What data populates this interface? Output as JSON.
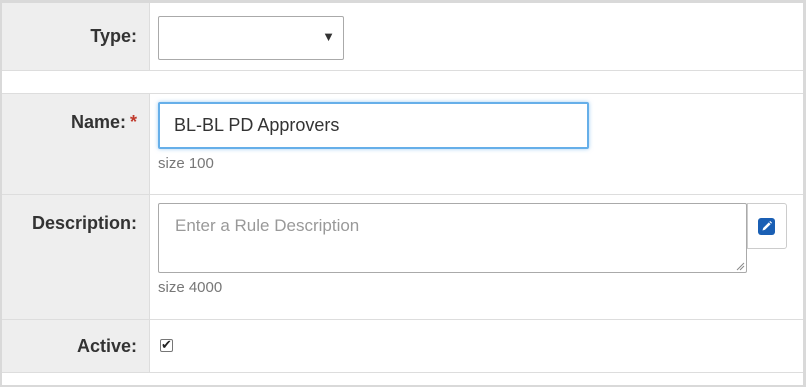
{
  "form": {
    "type": {
      "label": "Type:",
      "value": "",
      "arrow": "▼"
    },
    "name": {
      "label": "Name:",
      "required_marker": "*",
      "value": "BL-BL PD Approvers",
      "hint": "size 100"
    },
    "description": {
      "label": "Description:",
      "value": "",
      "placeholder": "Enter a Rule Description",
      "hint": "size 4000",
      "edit_icon": "pencil-icon"
    },
    "active": {
      "label": "Active:",
      "checked": true,
      "check_glyph": "✔"
    }
  },
  "colors": {
    "label_bg": "#eeeeee",
    "required": "#c0392b",
    "focus_border": "#66afe9",
    "edit_icon_bg": "#1a5fb4"
  }
}
